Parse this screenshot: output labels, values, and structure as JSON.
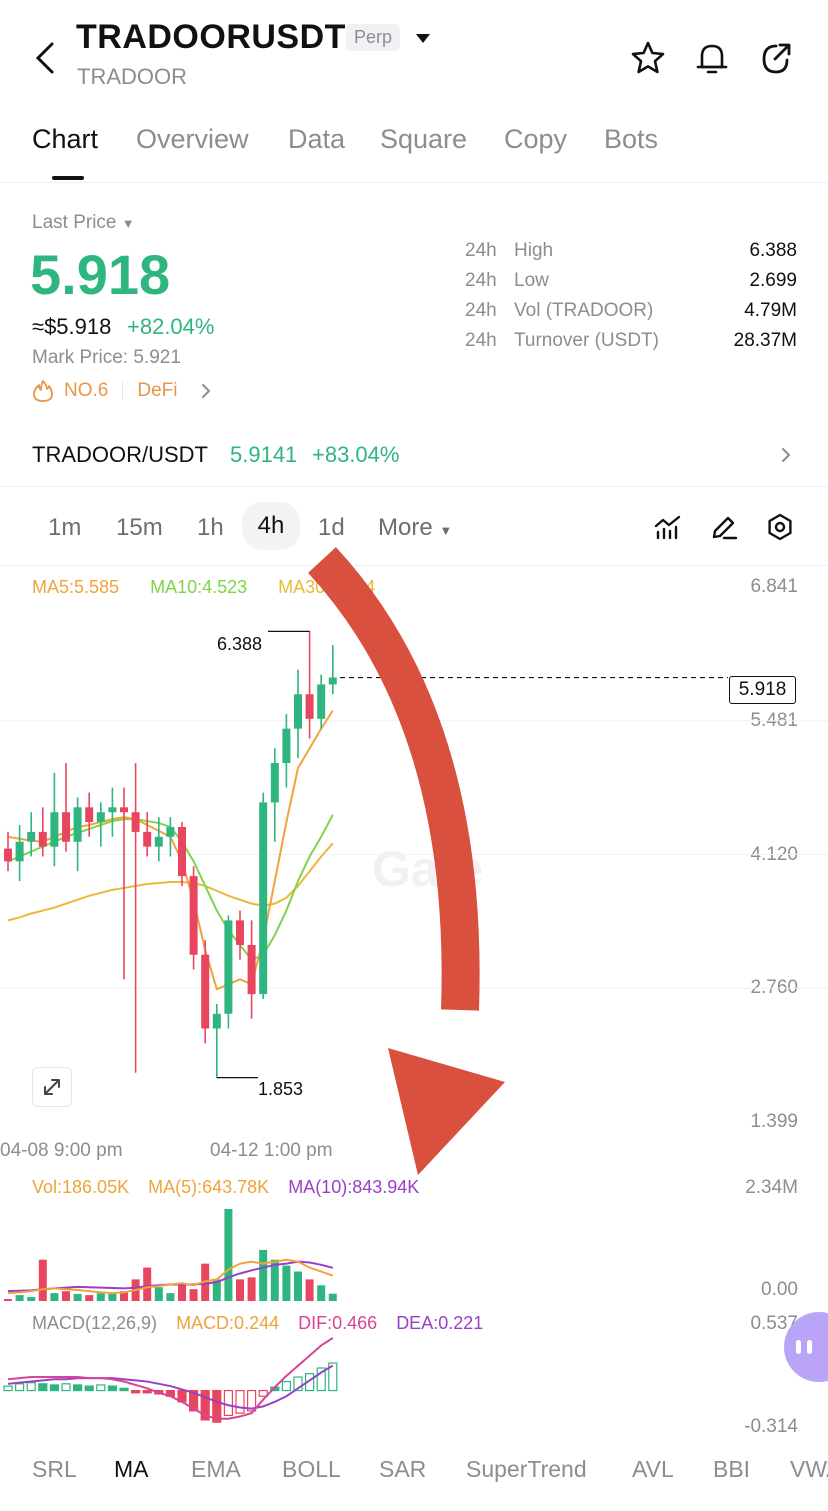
{
  "header": {
    "title": "TRADOORUSDT",
    "badge": "Perp",
    "subtitle": "TRADOOR"
  },
  "tabs": [
    {
      "label": "Chart",
      "active": true
    },
    {
      "label": "Overview",
      "active": false
    },
    {
      "label": "Data",
      "active": false
    },
    {
      "label": "Square",
      "active": false
    },
    {
      "label": "Copy",
      "active": false
    },
    {
      "label": "Bots",
      "active": false
    }
  ],
  "price": {
    "last_price_label": "Last Price",
    "last_price": "5.918",
    "approx_usd": "≈$5.918",
    "change_pct": "+82.04%",
    "mark_price": "Mark Price: 5.921",
    "rank": "NO.6",
    "category": "DeFi"
  },
  "stats": [
    {
      "period": "24h",
      "label": "High",
      "value": "6.388"
    },
    {
      "period": "24h",
      "label": "Low",
      "value": "2.699"
    },
    {
      "period": "24h",
      "label": "Vol (TRADOOR)",
      "value": "4.79M"
    },
    {
      "period": "24h",
      "label": "Turnover (USDT)",
      "value": "28.37M"
    }
  ],
  "spot": {
    "pair": "TRADOOR/USDT",
    "price": "5.9141",
    "change": "+83.04%"
  },
  "timeframes": [
    {
      "label": "1m",
      "active": false
    },
    {
      "label": "15m",
      "active": false
    },
    {
      "label": "1h",
      "active": false
    },
    {
      "label": "4h",
      "active": true
    },
    {
      "label": "1d",
      "active": false
    },
    {
      "label": "More",
      "active": false
    }
  ],
  "ma_legend": {
    "ma5": "MA5:5.585",
    "ma10": "MA10:4.523",
    "ma30": "MA30:3.234"
  },
  "price_axis": [
    "6.841",
    "5.481",
    "4.120",
    "2.760",
    "1.399"
  ],
  "current_price_tag": "5.918",
  "high_marker": "6.388",
  "low_marker": "1.853",
  "time_axis": [
    "04-08 9:00 pm",
    "04-12 1:00 pm"
  ],
  "watermark": "Gate",
  "volume": {
    "vol": "Vol:186.05K",
    "ma5": "MA(5):643.78K",
    "ma10": "MA(10):843.94K",
    "axis_top": "2.34M",
    "axis_bottom": "0.00"
  },
  "macd": {
    "label": "MACD(12,26,9)",
    "macd": "MACD:0.244",
    "dif": "DIF:0.466",
    "dea": "DEA:0.221",
    "axis_top": "0.537",
    "axis_bottom": "-0.314"
  },
  "indicator_tabs": [
    {
      "label": "SRL",
      "active": false
    },
    {
      "label": "MA",
      "active": true
    },
    {
      "label": "EMA",
      "active": false
    },
    {
      "label": "BOLL",
      "active": false
    },
    {
      "label": "SAR",
      "active": false
    },
    {
      "label": "SuperTrend",
      "active": false
    },
    {
      "label": "AVL",
      "active": false
    },
    {
      "label": "BBI",
      "active": false
    },
    {
      "label": "VWAP",
      "active": false
    }
  ],
  "colors": {
    "up": "#2fb57f",
    "down": "#e8465e",
    "ma5": "#f0a33b",
    "ma10": "#7fd44a",
    "ma30": "#e8b93a",
    "dif": "#d64595",
    "dea": "#9a3fc8",
    "arrow": "#d9503f"
  },
  "chart_data": {
    "type": "candlestick",
    "candles": [
      {
        "o": 4.18,
        "h": 4.35,
        "l": 3.95,
        "c": 4.05
      },
      {
        "o": 4.05,
        "h": 4.42,
        "l": 3.85,
        "c": 4.25
      },
      {
        "o": 4.25,
        "h": 4.55,
        "l": 4.1,
        "c": 4.35
      },
      {
        "o": 4.35,
        "h": 4.6,
        "l": 4.1,
        "c": 4.2
      },
      {
        "o": 4.2,
        "h": 4.95,
        "l": 4.0,
        "c": 4.55
      },
      {
        "o": 4.55,
        "h": 5.05,
        "l": 4.15,
        "c": 4.25
      },
      {
        "o": 4.25,
        "h": 4.7,
        "l": 3.95,
        "c": 4.6
      },
      {
        "o": 4.6,
        "h": 4.75,
        "l": 4.3,
        "c": 4.45
      },
      {
        "o": 4.45,
        "h": 4.65,
        "l": 4.2,
        "c": 4.55
      },
      {
        "o": 4.55,
        "h": 4.8,
        "l": 4.3,
        "c": 4.6
      },
      {
        "o": 4.6,
        "h": 4.8,
        "l": 2.85,
        "c": 4.55
      },
      {
        "o": 4.55,
        "h": 5.05,
        "l": 1.9,
        "c": 4.35
      },
      {
        "o": 4.35,
        "h": 4.55,
        "l": 4.1,
        "c": 4.2
      },
      {
        "o": 4.2,
        "h": 4.5,
        "l": 4.05,
        "c": 4.3
      },
      {
        "o": 4.3,
        "h": 4.5,
        "l": 4.1,
        "c": 4.4
      },
      {
        "o": 4.4,
        "h": 4.45,
        "l": 3.8,
        "c": 3.9
      },
      {
        "o": 3.9,
        "h": 4.0,
        "l": 2.95,
        "c": 3.1
      },
      {
        "o": 3.1,
        "h": 3.25,
        "l": 2.2,
        "c": 2.35
      },
      {
        "o": 2.35,
        "h": 2.6,
        "l": 1.85,
        "c": 2.5
      },
      {
        "o": 2.5,
        "h": 3.5,
        "l": 2.35,
        "c": 3.45
      },
      {
        "o": 3.45,
        "h": 3.55,
        "l": 3.05,
        "c": 3.2
      },
      {
        "o": 3.2,
        "h": 3.45,
        "l": 2.45,
        "c": 2.7
      },
      {
        "o": 2.7,
        "h": 4.75,
        "l": 2.65,
        "c": 4.65
      },
      {
        "o": 4.65,
        "h": 5.2,
        "l": 4.25,
        "c": 5.05
      },
      {
        "o": 5.05,
        "h": 5.55,
        "l": 4.8,
        "c": 5.4
      },
      {
        "o": 5.4,
        "h": 6.0,
        "l": 5.1,
        "c": 5.75
      },
      {
        "o": 5.75,
        "h": 6.39,
        "l": 5.3,
        "c": 5.5
      },
      {
        "o": 5.5,
        "h": 5.95,
        "l": 5.4,
        "c": 5.85
      },
      {
        "o": 5.85,
        "h": 6.25,
        "l": 5.75,
        "c": 5.92
      }
    ],
    "ma5": [
      4.3,
      4.28,
      4.26,
      4.25,
      4.3,
      4.35,
      4.4,
      4.42,
      4.45,
      4.48,
      4.5,
      4.48,
      4.42,
      4.36,
      4.3,
      4.05,
      3.65,
      3.15,
      2.75,
      2.8,
      2.85,
      2.8,
      3.25,
      3.85,
      4.45,
      5.0,
      5.2,
      5.4,
      5.585
    ],
    "ma10": [
      4.05,
      4.1,
      4.15,
      4.2,
      4.25,
      4.3,
      4.34,
      4.38,
      4.42,
      4.46,
      4.48,
      4.48,
      4.46,
      4.44,
      4.4,
      4.25,
      4.05,
      3.8,
      3.55,
      3.35,
      3.2,
      3.05,
      3.1,
      3.3,
      3.55,
      3.85,
      4.1,
      4.3,
      4.523
    ],
    "ma30": [
      3.45,
      3.48,
      3.52,
      3.55,
      3.58,
      3.62,
      3.66,
      3.7,
      3.73,
      3.76,
      3.78,
      3.8,
      3.82,
      3.83,
      3.84,
      3.84,
      3.83,
      3.8,
      3.75,
      3.7,
      3.66,
      3.62,
      3.6,
      3.62,
      3.68,
      3.8,
      3.95,
      4.1,
      4.234
    ],
    "volume": [
      0.05,
      0.15,
      0.1,
      1.05,
      0.2,
      0.25,
      0.18,
      0.15,
      0.2,
      0.18,
      0.25,
      0.55,
      0.85,
      0.35,
      0.2,
      0.45,
      0.3,
      0.95,
      0.55,
      2.34,
      0.55,
      0.6,
      1.3,
      1.05,
      0.9,
      0.75,
      0.55,
      0.4,
      0.186
    ],
    "vol_ma5": [
      0.2,
      0.22,
      0.25,
      0.3,
      0.32,
      0.3,
      0.28,
      0.25,
      0.22,
      0.2,
      0.22,
      0.28,
      0.35,
      0.38,
      0.42,
      0.45,
      0.4,
      0.5,
      0.55,
      0.8,
      0.95,
      1.0,
      0.95,
      1.0,
      1.05,
      1.0,
      0.85,
      0.75,
      0.644
    ],
    "vol_ma10": [
      0.25,
      0.26,
      0.27,
      0.3,
      0.32,
      0.34,
      0.36,
      0.35,
      0.34,
      0.33,
      0.32,
      0.34,
      0.38,
      0.4,
      0.42,
      0.42,
      0.42,
      0.44,
      0.48,
      0.6,
      0.7,
      0.78,
      0.85,
      0.92,
      0.95,
      1.0,
      0.98,
      0.92,
      0.844
    ],
    "macd_hist": [
      0.04,
      0.06,
      0.07,
      0.06,
      0.05,
      0.06,
      0.05,
      0.04,
      0.05,
      0.04,
      0.02,
      -0.02,
      -0.02,
      -0.03,
      -0.05,
      -0.1,
      -0.18,
      -0.26,
      -0.28,
      -0.22,
      -0.2,
      -0.18,
      -0.05,
      0.03,
      0.08,
      0.12,
      0.15,
      0.2,
      0.244
    ],
    "dif": [
      0.1,
      0.11,
      0.12,
      0.12,
      0.12,
      0.12,
      0.12,
      0.11,
      0.11,
      0.1,
      0.08,
      0.05,
      0.02,
      -0.02,
      -0.05,
      -0.1,
      -0.16,
      -0.22,
      -0.25,
      -0.25,
      -0.23,
      -0.2,
      -0.08,
      0.03,
      0.13,
      0.22,
      0.31,
      0.4,
      0.466
    ],
    "dea": [
      0.06,
      0.07,
      0.08,
      0.09,
      0.1,
      0.1,
      0.11,
      0.11,
      0.11,
      0.11,
      0.1,
      0.09,
      0.08,
      0.06,
      0.04,
      0.01,
      -0.02,
      -0.06,
      -0.1,
      -0.13,
      -0.15,
      -0.16,
      -0.14,
      -0.1,
      -0.05,
      0.02,
      0.09,
      0.16,
      0.221
    ],
    "price_range": [
      1.399,
      6.841
    ],
    "volume_range": [
      0,
      2.34
    ],
    "macd_range": [
      -0.314,
      0.537
    ]
  }
}
